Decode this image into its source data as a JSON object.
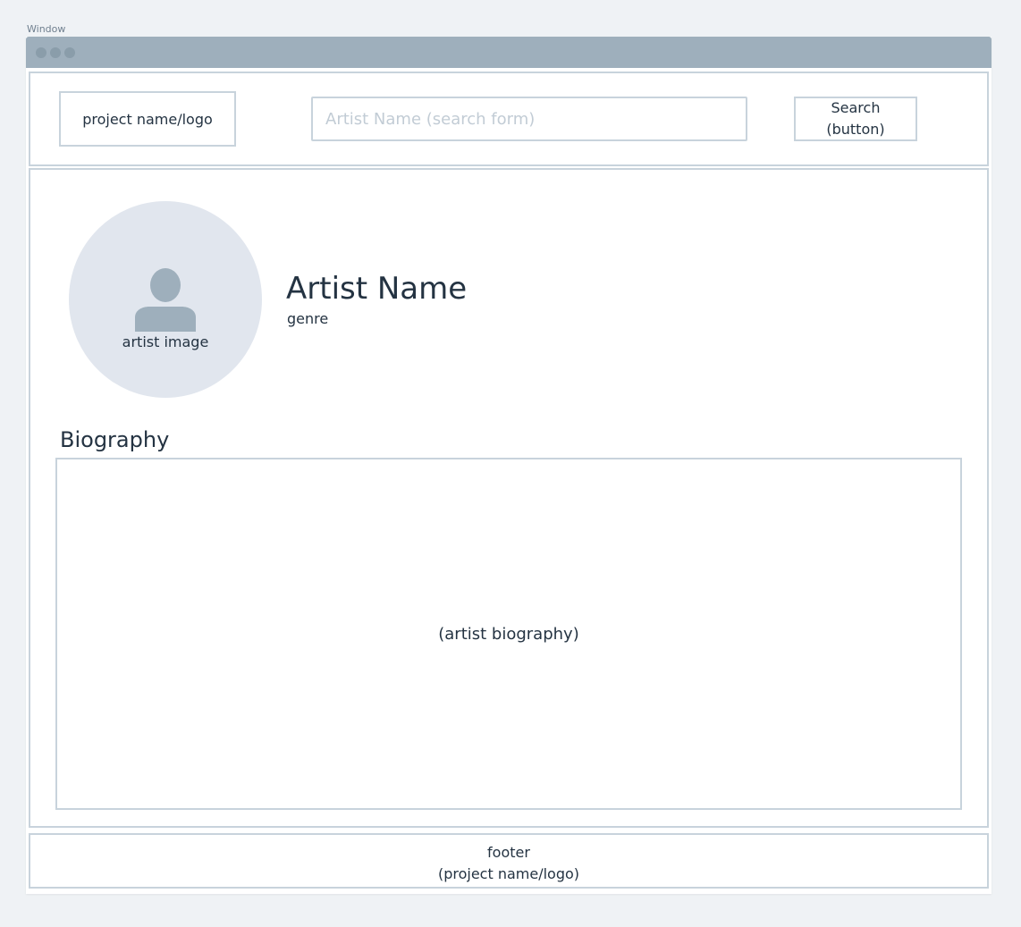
{
  "window": {
    "label": "Window"
  },
  "header": {
    "logo": "project name/logo",
    "search_placeholder": "Artist Name (search form)",
    "search_button": "Search\n(button)"
  },
  "artist": {
    "image_label": "artist image",
    "name": "Artist Name",
    "genre": "genre"
  },
  "biography": {
    "heading": "Biography",
    "content": "(artist biography)"
  },
  "footer": {
    "text": "footer\n(project name/logo)"
  },
  "icons": {
    "avatar": "person-icon",
    "window_controls": "window-dot-icon"
  },
  "colors": {
    "page_background": "#eff2f5",
    "titlebar": "#9eafbc",
    "border": "#c8d3dc",
    "text": "#243342",
    "avatar_background": "#e1e6ee",
    "avatar_icon": "#9eafbc"
  }
}
